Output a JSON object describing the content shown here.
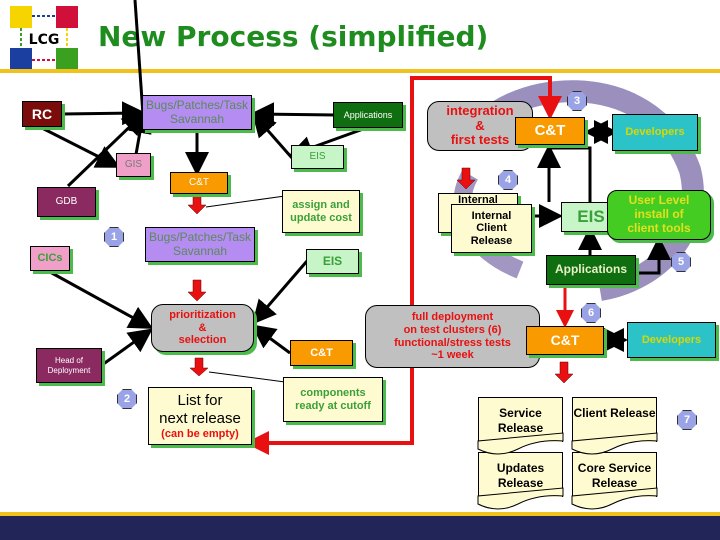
{
  "header": {
    "title": "New Process (simplified)",
    "logo_text": "LCG"
  },
  "colors": {
    "title_green": "#1e8c1e",
    "gold_rule": "#f2c21c",
    "footer_navy": "#212557",
    "rc_maroon": "#7a0c0c",
    "savannah_purple": "#b48cf2",
    "applications_green": "#0f6e0f",
    "eis_light_green": "#c8f5c8",
    "gis_pink": "#f0a0c8",
    "ct_orange": "#f89a00",
    "gdb_plum": "#8a2a60",
    "developers_teal": "#2cc3c8",
    "process_gray": "#c0c0c0",
    "note_yellow": "#fffbd0",
    "flow_red": "#e81010",
    "badge_lavender": "#9aa3e6"
  },
  "left_flow": {
    "rc": "RC",
    "savannah_top": "Bugs/Patches/Task\nSavannah",
    "applications": "Applications",
    "eis_top": "EIS",
    "gis": "GIS",
    "ct_small": "C&T",
    "gdb": "GDB",
    "badge_1": "1",
    "cics": "CICs",
    "savannah_mid": "Bugs/Patches/Task\nSavannah",
    "assign_note": "assign and\nupdate cost",
    "eis_mid": "EIS",
    "prioritization": "prioritization\n&\nselection",
    "head_of_deployment": "Head of\nDeployment",
    "ct_mid": "C&T",
    "list_title": "List for\nnext release",
    "list_sub": "(can be empty)",
    "components_note": "components\nready at cutoff",
    "badge_2": "2"
  },
  "right_flow": {
    "integration": "integration\n&\nfirst tests",
    "badge_3": "3",
    "ct_top": "C&T",
    "developers_top": "Developers",
    "badge_4": "4",
    "internal_back": "Internal",
    "internal_release": "Internal\nClient\nRelease",
    "eis": "EIS",
    "user_level": "User Level\ninstall of\nclient tools",
    "applications": "Applications",
    "badge_5": "5",
    "badge_6": "6",
    "full_deployment": "full deployment\non test clusters (6)\nfunctional/stress tests\n~1 week",
    "ct_bottom": "C&T",
    "developers_bottom": "Developers",
    "releases": [
      "Service\nRelease",
      "Client\nRelease",
      "Updates\nRelease",
      "Core Service\nRelease"
    ],
    "badge_7": "7"
  }
}
